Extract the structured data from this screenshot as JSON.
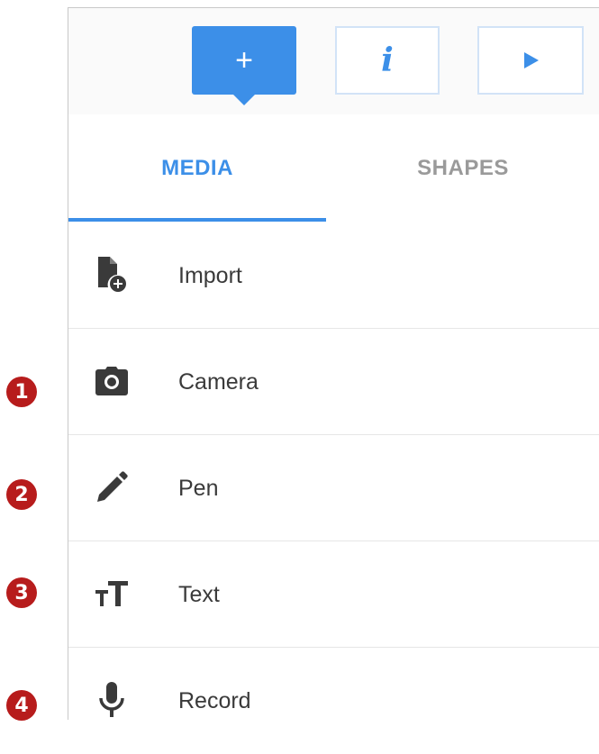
{
  "toolbar": {
    "add_label": "+",
    "info_label": "i",
    "accent_color": "#3c8fe8"
  },
  "tabs": [
    {
      "label": "MEDIA",
      "active": true
    },
    {
      "label": "SHAPES",
      "active": false
    }
  ],
  "media_items": [
    {
      "label": "Import",
      "icon": "file-add-icon"
    },
    {
      "label": "Camera",
      "icon": "camera-icon"
    },
    {
      "label": "Pen",
      "icon": "pen-icon"
    },
    {
      "label": "Text",
      "icon": "text-size-icon"
    },
    {
      "label": "Record",
      "icon": "microphone-icon"
    }
  ],
  "callouts": [
    "1",
    "2",
    "3",
    "4"
  ],
  "callout_color": "#b71c1c"
}
